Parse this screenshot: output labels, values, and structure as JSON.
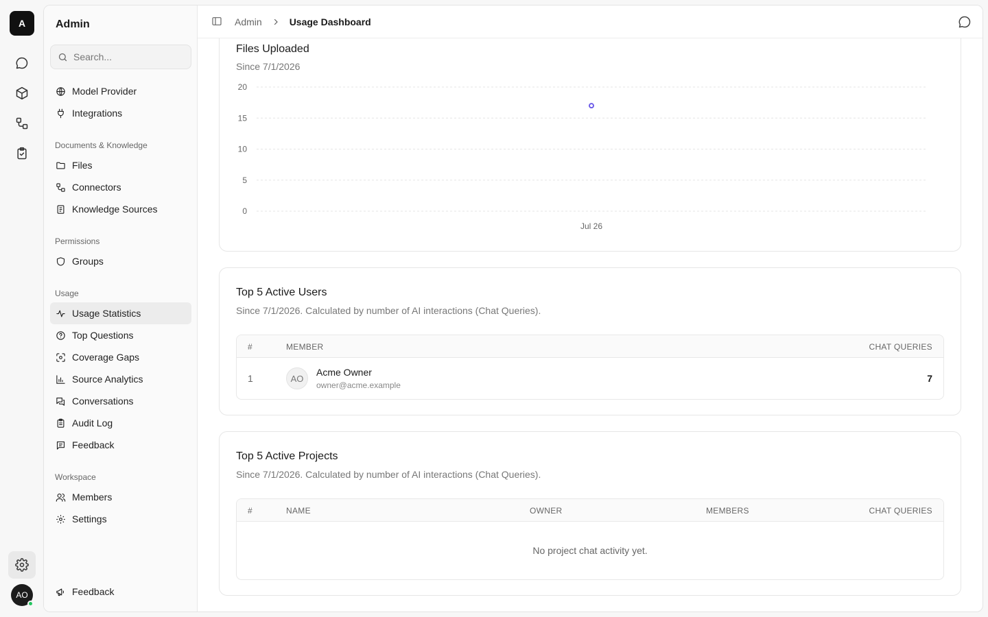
{
  "rail": {
    "logo": "A",
    "avatar": "AO",
    "icons": [
      "chat-icon",
      "cube-icon",
      "connectors-icon",
      "clipboard-check-icon",
      "gear-icon"
    ]
  },
  "sidebar": {
    "title": "Admin",
    "search_placeholder": "Search...",
    "sections": [
      {
        "label": "",
        "items": [
          {
            "label": "Model Provider",
            "icon": "globe-icon"
          },
          {
            "label": "Integrations",
            "icon": "plug-icon"
          }
        ]
      },
      {
        "label": "Documents & Knowledge",
        "items": [
          {
            "label": "Files",
            "icon": "folder-icon"
          },
          {
            "label": "Connectors",
            "icon": "connectors-icon"
          },
          {
            "label": "Knowledge Sources",
            "icon": "book-icon"
          }
        ]
      },
      {
        "label": "Permissions",
        "items": [
          {
            "label": "Groups",
            "icon": "shield-icon"
          }
        ]
      },
      {
        "label": "Usage",
        "items": [
          {
            "label": "Usage Statistics",
            "icon": "activity-icon",
            "active": true
          },
          {
            "label": "Top Questions",
            "icon": "help-circle-icon"
          },
          {
            "label": "Coverage Gaps",
            "icon": "scan-icon"
          },
          {
            "label": "Source Analytics",
            "icon": "bar-chart-icon"
          },
          {
            "label": "Conversations",
            "icon": "messages-icon"
          },
          {
            "label": "Audit Log",
            "icon": "clipboard-icon"
          },
          {
            "label": "Feedback",
            "icon": "message-square-text-icon"
          }
        ]
      },
      {
        "label": "Workspace",
        "items": [
          {
            "label": "Members",
            "icon": "users-icon"
          },
          {
            "label": "Settings",
            "icon": "gear-icon"
          }
        ]
      }
    ],
    "footer_item": "Feedback"
  },
  "header": {
    "breadcrumb_parent": "Admin",
    "breadcrumb_current": "Usage Dashboard"
  },
  "files_card": {
    "title": "Files Uploaded",
    "subtitle": "Since 7/1/2026"
  },
  "chart_data": {
    "type": "scatter",
    "title": "Files Uploaded",
    "subtitle": "Since 7/1/2026",
    "x": [
      "Jul 26"
    ],
    "y": [
      17
    ],
    "ylim": [
      0,
      20
    ],
    "yticks": [
      0,
      5,
      10,
      15,
      20
    ],
    "xticks": [
      "Jul 26"
    ],
    "xlabel": "",
    "ylabel": "",
    "grid": true,
    "color": "#6d5ce8"
  },
  "users_card": {
    "title": "Top 5 Active Users",
    "subtitle": "Since 7/1/2026. Calculated by number of AI interactions (Chat Queries).",
    "columns": [
      "#",
      "MEMBER",
      "CHAT QUERIES"
    ],
    "rows": [
      {
        "rank": "1",
        "initials": "AO",
        "name": "Acme Owner",
        "email": "owner@acme.example",
        "queries": "7"
      }
    ]
  },
  "projects_card": {
    "title": "Top 5 Active Projects",
    "subtitle": "Since 7/1/2026. Calculated by number of AI interactions (Chat Queries).",
    "columns": [
      "#",
      "NAME",
      "OWNER",
      "MEMBERS",
      "CHAT QUERIES"
    ],
    "empty_text": "No project chat activity yet."
  }
}
